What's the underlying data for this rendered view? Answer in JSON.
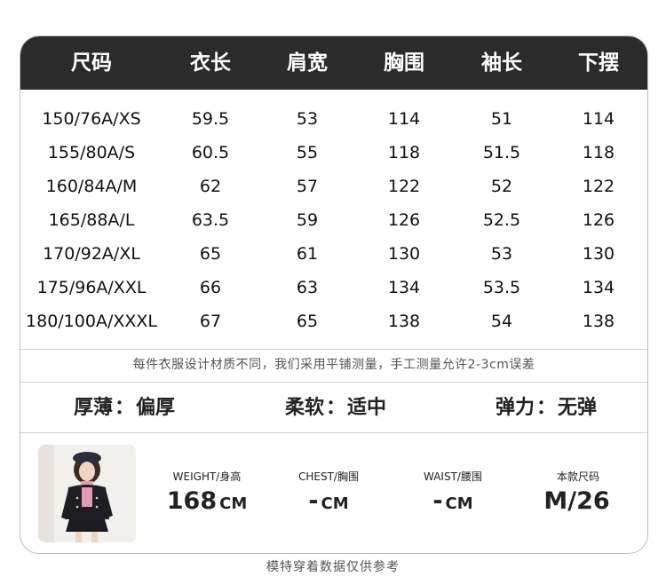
{
  "table": {
    "headers": [
      "尺码",
      "衣长",
      "肩宽",
      "胸围",
      "袖长",
      "下摆"
    ],
    "rows": [
      [
        "150/76A/XS",
        "59.5",
        "53",
        "114",
        "51",
        "114"
      ],
      [
        "155/80A/S",
        "60.5",
        "55",
        "118",
        "51.5",
        "118"
      ],
      [
        "160/84A/M",
        "62",
        "57",
        "122",
        "52",
        "122"
      ],
      [
        "165/88A/L",
        "63.5",
        "59",
        "126",
        "52.5",
        "126"
      ],
      [
        "170/92A/XL",
        "65",
        "61",
        "130",
        "53",
        "130"
      ],
      [
        "175/96A/XXL",
        "66",
        "63",
        "134",
        "53.5",
        "134"
      ],
      [
        "180/100A/XXXL",
        "67",
        "65",
        "138",
        "54",
        "138"
      ]
    ]
  },
  "note": "每件衣服设计材质不同，我们采用平铺测量，手工测量允许2-3cm误差",
  "attributes": [
    {
      "label": "厚薄",
      "value": "偏厚"
    },
    {
      "label": "柔软",
      "value": "适中"
    },
    {
      "label": "弹力",
      "value": "无弹"
    }
  ],
  "colon": "：",
  "model": {
    "stats": [
      {
        "label": "WEIGHT/身高",
        "value": "168",
        "unit": "CM"
      },
      {
        "label": "CHEST/胸围",
        "value": "-",
        "unit": "CM"
      },
      {
        "label": "WAIST/腰围",
        "value": "-",
        "unit": "CM"
      },
      {
        "label": "本款尺码",
        "value": "M/26",
        "unit": ""
      }
    ]
  },
  "caption": "模特穿着数据仅供参考"
}
